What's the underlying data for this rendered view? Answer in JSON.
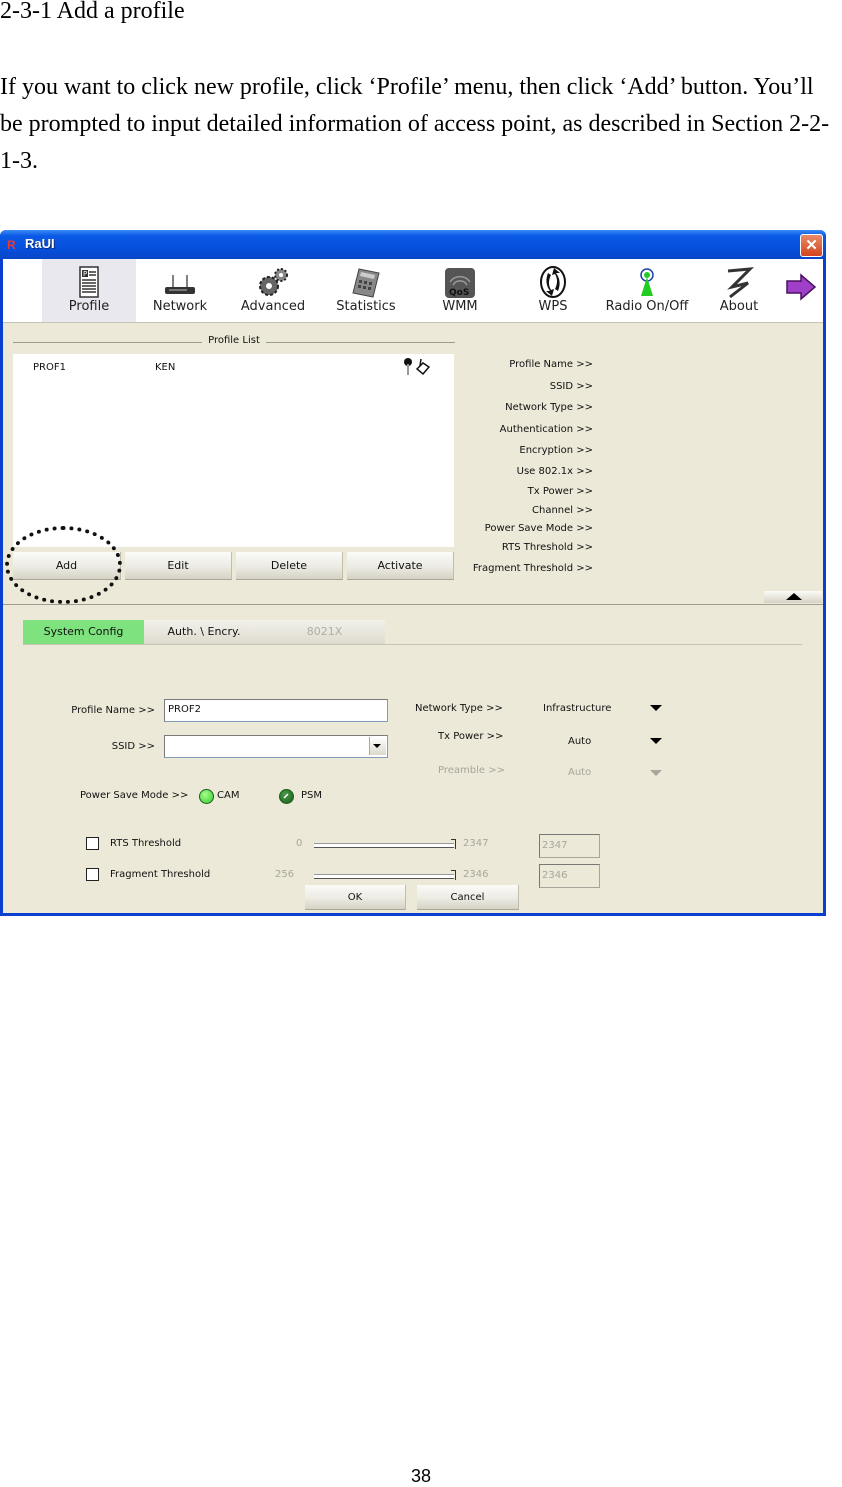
{
  "document": {
    "heading": "2-3-1 Add a profile",
    "paragraph": "If you want to click new profile, click ‘Profile’ menu, then click ‘Add’ button. You’ll be prompted to input detailed information of access point, as described in Section 2-2-1-3.",
    "page_number": "38"
  },
  "window": {
    "title": "RaUI",
    "logo_glyph": "R",
    "close_glyph": "✕"
  },
  "toolbar": {
    "items": [
      {
        "label": "Profile",
        "icon": "profile-icon",
        "active": true
      },
      {
        "label": "Network",
        "icon": "router-icon"
      },
      {
        "label": "Advanced",
        "icon": "gears-icon"
      },
      {
        "label": "Statistics",
        "icon": "calculator-icon"
      },
      {
        "label": "WMM",
        "icon": "qos-icon"
      },
      {
        "label": "WPS",
        "icon": "wps-icon"
      },
      {
        "label": "Radio On/Off",
        "icon": "radio-antenna-icon"
      },
      {
        "label": "About",
        "icon": "about-logo-icon"
      }
    ],
    "next_icon": "arrow-right-icon"
  },
  "profile_list": {
    "title": "Profile List",
    "rows": [
      {
        "name": "PROF1",
        "ssid": "KEN",
        "icons": "🔑✎"
      }
    ],
    "buttons": {
      "add": "Add",
      "edit": "Edit",
      "delete": "Delete",
      "activate": "Activate"
    }
  },
  "details_labels": [
    "Profile Name >>",
    "SSID >>",
    "Network Type >>",
    "Authentication >>",
    "Encryption >>",
    "Use 802.1x >>",
    "Tx Power >>",
    "Channel >>",
    "Power Save Mode >>",
    "RTS Threshold >>",
    "Fragment Threshold >>"
  ],
  "tabs": [
    {
      "label": "System Config",
      "state": "active"
    },
    {
      "label": "Auth. \\ Encry.",
      "state": "normal"
    },
    {
      "label": "8021X",
      "state": "disabled"
    }
  ],
  "form": {
    "profile_name_label": "Profile Name >>",
    "profile_name_value": "PROF2",
    "ssid_label": "SSID >>",
    "ssid_value": "",
    "network_type_label": "Network Type >>",
    "network_type_value": "Infrastructure",
    "tx_power_label": "Tx Power >>",
    "tx_power_value": "Auto",
    "preamble_label": "Preamble >>",
    "preamble_value": "Auto",
    "power_save_label": "Power Save Mode >>",
    "power_save_options": [
      "CAM",
      "PSM"
    ],
    "power_save_selected": "PSM",
    "rts": {
      "label": "RTS Threshold",
      "checked": false,
      "min": "0",
      "max": "2347",
      "value": "2347"
    },
    "frag": {
      "label": "Fragment Threshold",
      "checked": false,
      "min": "256",
      "max": "2346",
      "value": "2346"
    },
    "ok": "OK",
    "cancel": "Cancel"
  }
}
